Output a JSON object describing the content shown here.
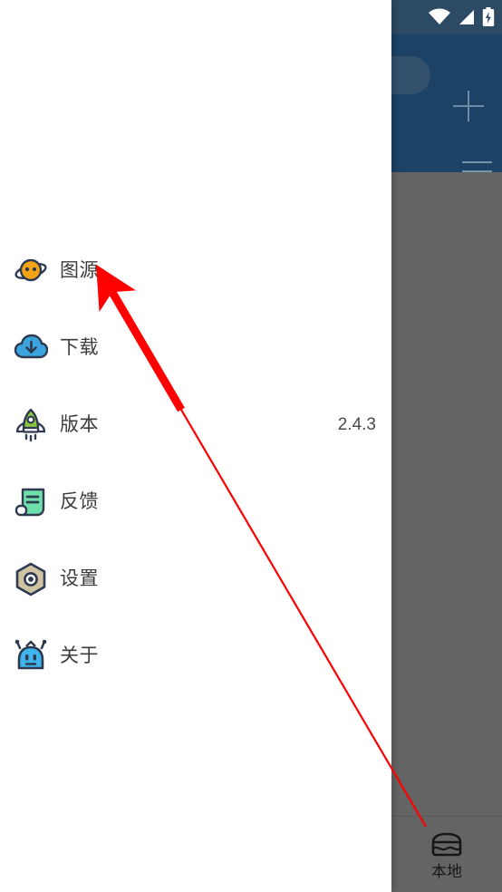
{
  "status_bar": {
    "background_color": "#2c4a64",
    "icons": [
      "wifi-icon",
      "cell-signal-icon",
      "battery-charging-icon"
    ]
  },
  "app_toolbar": {
    "background_color": "#1c4266",
    "search_pill_color": "#33506d",
    "add_icon": "plus-icon",
    "menu_icon": "hamburger-icon"
  },
  "bottom_nav": {
    "items": [
      {
        "label": "本地",
        "icon": "store-icon"
      }
    ]
  },
  "drawer": {
    "background_color": "#ffffff",
    "items": [
      {
        "label": "图源",
        "icon": "planet-icon",
        "value": ""
      },
      {
        "label": "下载",
        "icon": "cloud-download-icon",
        "value": ""
      },
      {
        "label": "版本",
        "icon": "rocket-icon",
        "value": "2.4.3"
      },
      {
        "label": "反馈",
        "icon": "newspaper-icon",
        "value": ""
      },
      {
        "label": "设置",
        "icon": "hex-gear-icon",
        "value": ""
      },
      {
        "label": "关于",
        "icon": "robot-icon",
        "value": ""
      }
    ]
  },
  "annotation": {
    "arrow_color": "#ff0000",
    "points_to": "图源"
  }
}
